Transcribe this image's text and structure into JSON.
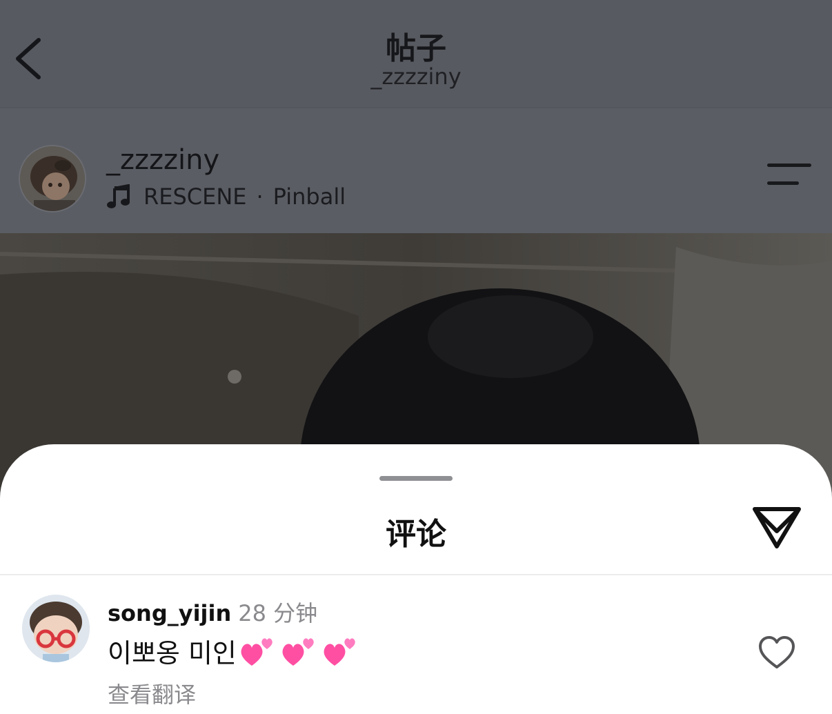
{
  "nav": {
    "title": "帖子",
    "subtitle": "_zzzziny"
  },
  "post": {
    "username": "_zzzziny",
    "music_artist": "RESCENE",
    "music_separator": "·",
    "music_track": "Pinball"
  },
  "comments_sheet": {
    "title": "评论",
    "comments": [
      {
        "username": "song_yijin",
        "time": "28 分钟",
        "text": "이뽀옹 미인",
        "emoji": [
          "💕",
          "💕",
          "💕"
        ],
        "translate_label": "查看翻译"
      }
    ]
  },
  "icons": {
    "back": "chevron-left-icon",
    "music": "music-note-icon",
    "menu": "menu-lines-icon",
    "share": "send-icon",
    "like": "heart-outline-icon",
    "emoji": "two-hearts-icon"
  },
  "colors": {
    "overlay": "#585a61",
    "sheet_background": "#ffffff",
    "heart_emoji": "#ff4fa3",
    "secondary_text": "#8a8a8e"
  }
}
